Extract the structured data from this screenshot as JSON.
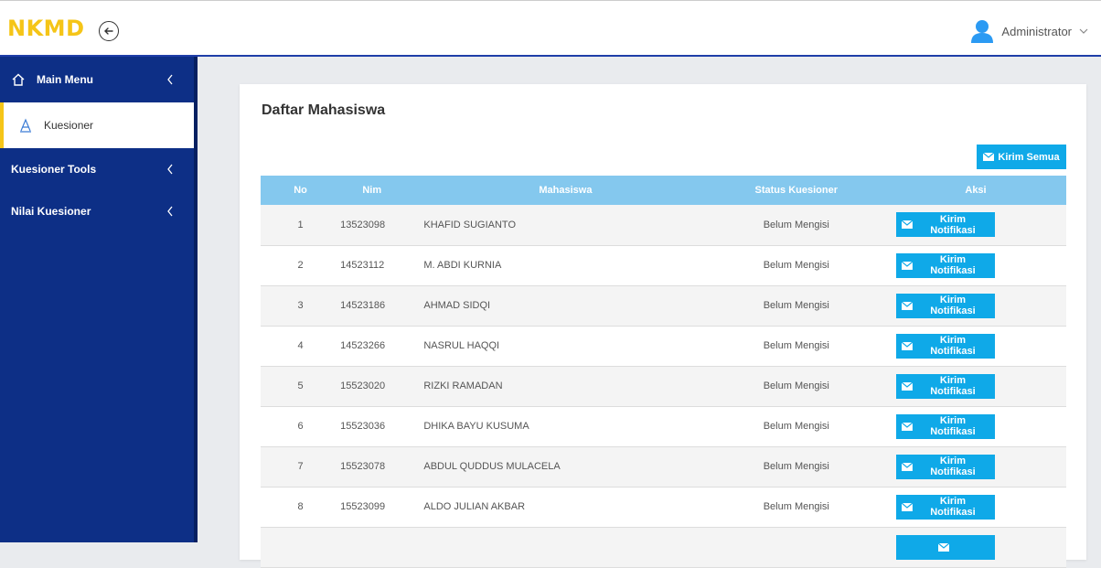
{
  "app": {
    "logo": "NKMD",
    "user_name": "Administrator"
  },
  "sidebar": {
    "items": [
      {
        "label": "Main Menu"
      },
      {
        "label": "Kuesioner"
      },
      {
        "label": "Kuesioner Tools"
      },
      {
        "label": "Nilai Kuesioner"
      }
    ]
  },
  "main": {
    "title": "Daftar Mahasiswa",
    "send_all_label": "Kirim Semua",
    "table": {
      "headers": [
        "No",
        "Nim",
        "Mahasiswa",
        "Status Kuesioner",
        "Aksi"
      ],
      "rows": [
        {
          "no": "1",
          "nim": "13523098",
          "name": "KHAFID SUGIANTO",
          "status": "Belum Mengisi",
          "action": "Kirim Notifikasi"
        },
        {
          "no": "2",
          "nim": "14523112",
          "name": "M. ABDI KURNIA",
          "status": "Belum Mengisi",
          "action": "Kirim Notifikasi"
        },
        {
          "no": "3",
          "nim": "14523186",
          "name": "AHMAD SIDQI",
          "status": "Belum Mengisi",
          "action": "Kirim Notifikasi"
        },
        {
          "no": "4",
          "nim": "14523266",
          "name": "NASRUL HAQQI",
          "status": "Belum Mengisi",
          "action": "Kirim Notifikasi"
        },
        {
          "no": "5",
          "nim": "15523020",
          "name": "RIZKI RAMADAN",
          "status": "Belum Mengisi",
          "action": "Kirim Notifikasi"
        },
        {
          "no": "6",
          "nim": "15523036",
          "name": "DHIKA BAYU KUSUMA",
          "status": "Belum Mengisi",
          "action": "Kirim Notifikasi"
        },
        {
          "no": "7",
          "nim": "15523078",
          "name": "ABDUL QUDDUS MULACELA",
          "status": "Belum Mengisi",
          "action": "Kirim Notifikasi"
        },
        {
          "no": "8",
          "nim": "15523099",
          "name": "ALDO JULIAN AKBAR",
          "status": "Belum Mengisi",
          "action": "Kirim Notifikasi"
        },
        {
          "no": "",
          "nim": "",
          "name": "",
          "status": "",
          "action": ""
        }
      ]
    }
  },
  "colors": {
    "brand": "#f5c518",
    "sidebar": "#0d2f86",
    "header_row": "#84c8ee",
    "button": "#0fa9e8"
  },
  "icons": {
    "toggle": "arrow-left-circle-icon",
    "home": "home-icon",
    "kuesioner": "letter-a-icon",
    "chevron": "chevron-left-icon",
    "envelope": "envelope-icon",
    "user": "user-avatar-icon"
  }
}
